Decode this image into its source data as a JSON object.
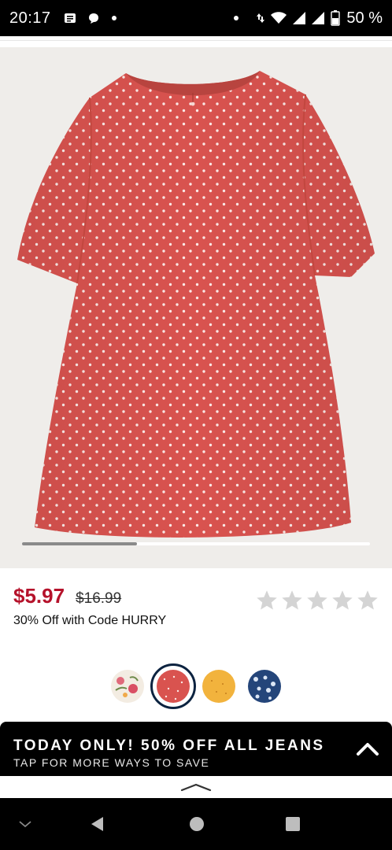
{
  "status_bar": {
    "time": "20:17",
    "battery_pct": "50 %",
    "icons": [
      "notes-icon",
      "chat-icon",
      "dot-icon",
      "dot-icon",
      "data-arrows-icon",
      "wifi-icon",
      "signal-icon",
      "signal-icon",
      "battery-icon"
    ]
  },
  "product": {
    "image_subject": "coral polka dot short-sleeve dress",
    "carousel_position": 0.33,
    "sale_price": "$5.97",
    "original_price": "$16.99",
    "promo_text": "30% Off with Code HURRY",
    "rating_stars": 0,
    "rating_max": 5
  },
  "swatches": [
    {
      "name": "floral-cream",
      "color": "#f3ece2",
      "selected": false
    },
    {
      "name": "coral-dot",
      "color": "#d9534f",
      "selected": true
    },
    {
      "name": "mustard",
      "color": "#f2b33d",
      "selected": false
    },
    {
      "name": "navy-floral",
      "color": "#24457a",
      "selected": false
    }
  ],
  "banner": {
    "title": "TODAY ONLY! 50% OFF ALL JEANS",
    "subtitle": "TAP FOR MORE WAYS TO SAVE"
  },
  "colors": {
    "sale_red": "#b5122b",
    "dress_coral": "#d9534f",
    "selected_ring": "#0c2340",
    "background_image": "#efedea"
  }
}
